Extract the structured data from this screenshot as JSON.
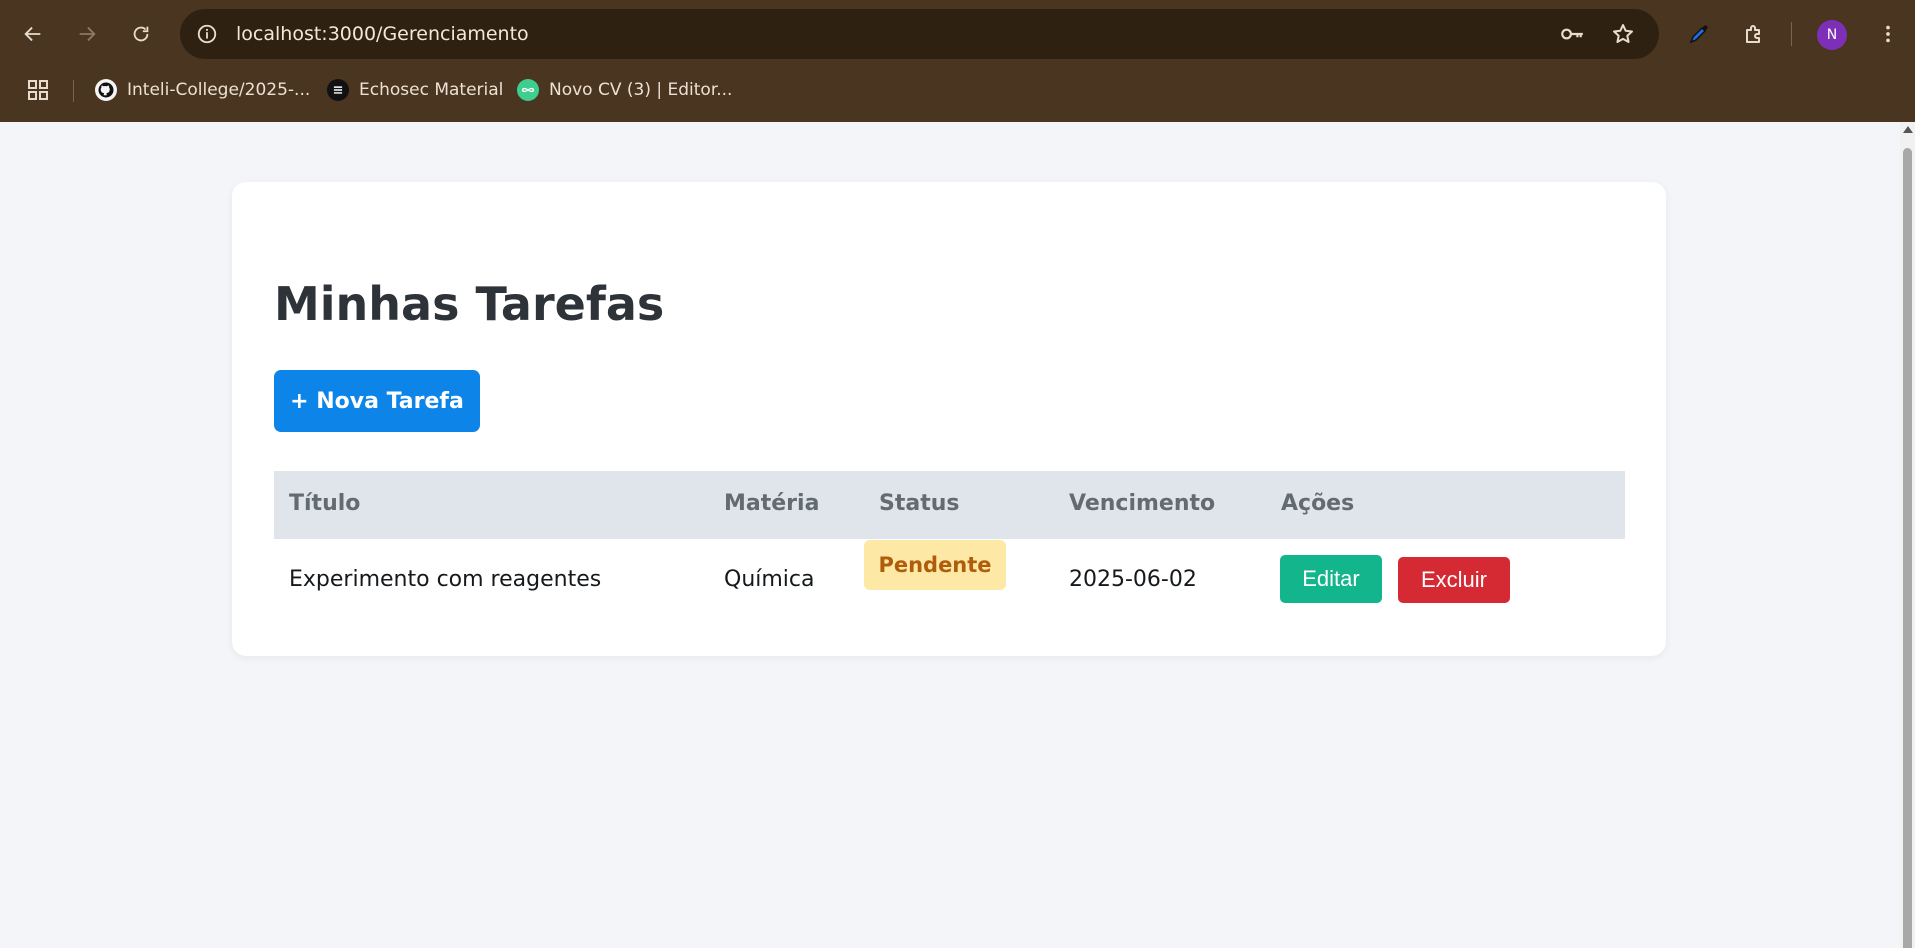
{
  "browser": {
    "url_host": "localhost",
    "url_path": ":3000/Gerenciamento",
    "avatar_initial": "N",
    "bookmarks": [
      {
        "label": "Inteli-College/2025-...",
        "icon": "github-icon"
      },
      {
        "label": "Echosec Material",
        "icon": "echosec-icon"
      },
      {
        "label": "Novo CV (3) | Editor...",
        "icon": "cv-editor-icon"
      }
    ]
  },
  "page": {
    "title": "Minhas Tarefas",
    "new_task_label": "+ Nova Tarefa",
    "table": {
      "headers": [
        "Título",
        "Matéria",
        "Status",
        "Vencimento",
        "Ações"
      ],
      "rows": [
        {
          "titulo": "Experimento com reagentes",
          "materia": "Química",
          "status": "Pendente",
          "vencimento": "2025-06-02",
          "edit_label": "Editar",
          "delete_label": "Excluir"
        }
      ]
    }
  },
  "colors": {
    "chrome": "#4a3520",
    "primary": "#0d84e8",
    "edit": "#12b58c",
    "delete": "#d52a33",
    "pending_bg": "#fde8a6",
    "pending_text": "#b05d0b"
  }
}
